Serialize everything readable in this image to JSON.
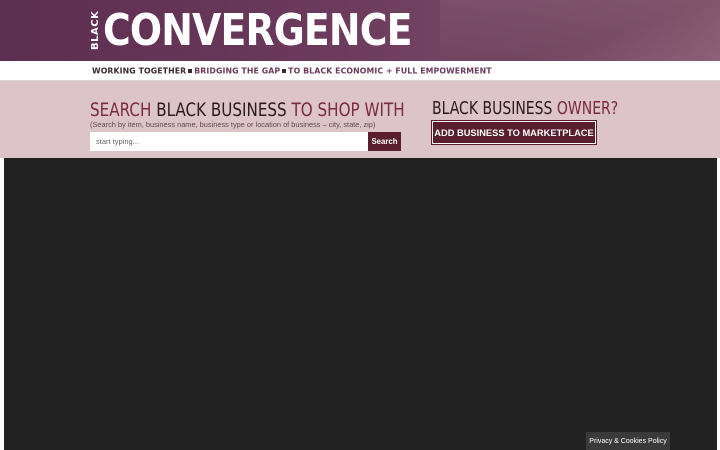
{
  "header": {
    "logo_small": "BLACK",
    "logo_big": "CONVERGENCE",
    "tagline": {
      "part1": "WORKING TOGETHER",
      "part2": "BRIDGING THE GAP",
      "part3": "TO BLACK ECONOMIC + FULL EMPOWERMENT"
    },
    "colors": {
      "banner": "#6b3a5c",
      "accent": "#5a1e30",
      "band": "#dcc4c8"
    }
  },
  "search": {
    "title_part1": "SEARCH ",
    "title_part2": "BLACK BUSINESS",
    "title_part3": " TO SHOP WITH",
    "hint": "(Search by item, business name, business type or location of business – city, state, zip)",
    "placeholder": "start typing...",
    "button_label": "Search"
  },
  "owner": {
    "title_part1": "BLACK BUSINESS",
    "title_part2": " OWNER?",
    "button_label": "ADD BUSINESS TO MARKETPLACE"
  },
  "footer": {
    "cookie_label": "Privacy & Cookies Policy"
  }
}
